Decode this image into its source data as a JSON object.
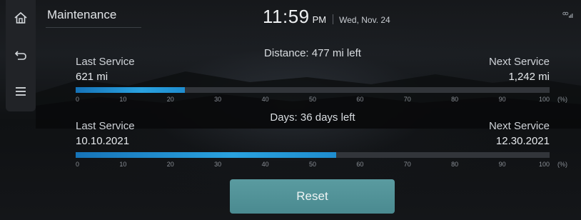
{
  "header": {
    "title": "Maintenance",
    "time": "11:59",
    "ampm": "PM",
    "date": "Wed, Nov. 24"
  },
  "sidebar": {
    "items": [
      {
        "icon": "home-icon"
      },
      {
        "icon": "back-icon"
      },
      {
        "icon": "menu-icon"
      }
    ]
  },
  "distance": {
    "remaining_label": "Distance: 477 mi left",
    "last_label": "Last Service",
    "last_value": "621 mi",
    "next_label": "Next Service",
    "next_value": "1,242 mi",
    "progress_percent": 23
  },
  "days": {
    "remaining_label": "Days: 36 days left",
    "last_label": "Last Service",
    "last_value": "10.10.2021",
    "next_label": "Next Service",
    "next_value": "12.30.2021",
    "progress_percent": 55
  },
  "scale": {
    "ticks": [
      "0",
      "10",
      "20",
      "30",
      "40",
      "50",
      "60",
      "70",
      "80",
      "90",
      "100"
    ],
    "unit": "(%)"
  },
  "actions": {
    "reset_label": "Reset"
  },
  "colors": {
    "accent": "#2aa2df",
    "button": "#4f9096"
  }
}
